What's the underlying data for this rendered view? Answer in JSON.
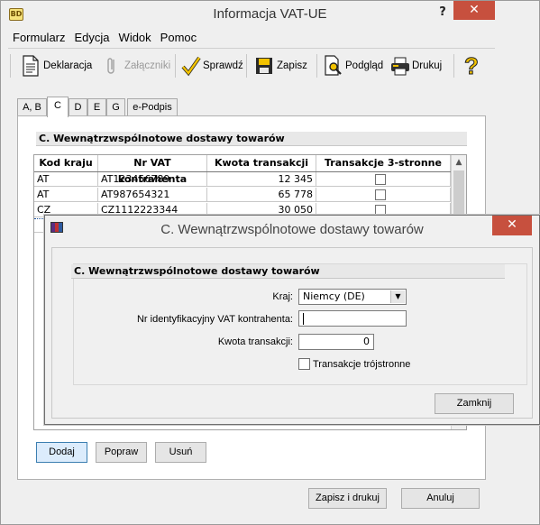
{
  "window": {
    "title": "Informacja VAT-UE",
    "icon_text": "BD",
    "help_glyph": "?",
    "close_glyph": "✕"
  },
  "menu": [
    "Formularz",
    "Edycja",
    "Widok",
    "Pomoc"
  ],
  "toolbar": {
    "deklaracja": "Deklaracja",
    "zalaczniki": "Załączniki",
    "sprawdz": "Sprawdź",
    "zapisz": "Zapisz",
    "podglad": "Podgląd",
    "drukuj": "Drukuj",
    "help_glyph": "?"
  },
  "tabs": [
    "A, B",
    "C",
    "D",
    "E",
    "G",
    "e-Podpis"
  ],
  "active_tab": "C",
  "section": {
    "title": "C. Wewnątrzwspólnotowe dostawy towarów"
  },
  "grid": {
    "columns": [
      "Kod kraju",
      "Nr VAT kontrahenta",
      "Kwota transakcji",
      "Transakcje 3-stronne"
    ],
    "rows": [
      {
        "country": "AT",
        "vat": "AT123456789",
        "amount": "12 345",
        "triangular": false
      },
      {
        "country": "AT",
        "vat": "AT987654321",
        "amount": "65 778",
        "triangular": false
      },
      {
        "country": "CZ",
        "vat": "CZ1112223344",
        "amount": "30 050",
        "triangular": false
      }
    ]
  },
  "buttons": {
    "dodaj": "Dodaj",
    "popraw": "Popraw",
    "usun": "Usuń",
    "zapisz_i_drukuj": "Zapisz i drukuj",
    "anuluj": "Anuluj"
  },
  "dialog": {
    "title": "C. Wewnątrzwspólnotowe dostawy towarów",
    "close_glyph": "✕",
    "section_title": "C. Wewnątrzwspólnotowe dostawy towarów",
    "kraj_label": "Kraj:",
    "kraj_value": "Niemcy (DE)",
    "vat_label": "Nr identyfikacyjny VAT kontrahenta:",
    "vat_value": "",
    "kwota_label": "Kwota transakcji:",
    "kwota_value": "0",
    "triangular_label": "Transakcje trójstronne",
    "triangular_checked": false,
    "close_button": "Zamknij"
  }
}
